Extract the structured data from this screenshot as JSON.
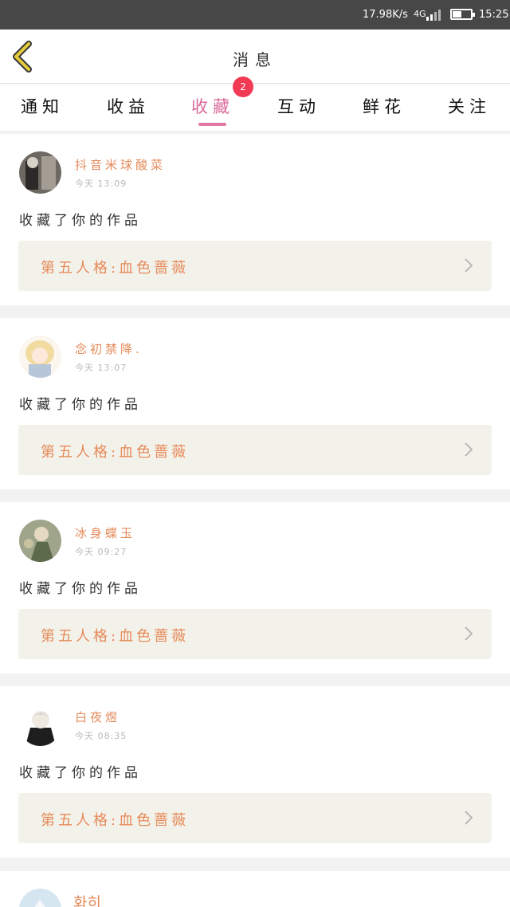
{
  "status_bar": {
    "speed": "17.98K/s",
    "network": "4G",
    "battery_level": 0.5,
    "time": "15:25"
  },
  "header": {
    "title": "消息",
    "accent_color": "#e4cc3a"
  },
  "tabs": [
    {
      "label": "通知"
    },
    {
      "label": "收益"
    },
    {
      "label": "收藏",
      "badge": "2",
      "active": true
    },
    {
      "label": "互动"
    },
    {
      "label": "鲜花"
    },
    {
      "label": "关注"
    }
  ],
  "messages": [
    {
      "username": "抖音米球酸菜",
      "time": "今天 13:09",
      "text": "收藏了你的作品",
      "work_title": "第五人格:血色蔷薇"
    },
    {
      "username": "念初禁降.",
      "time": "今天 13:07",
      "text": "收藏了你的作品",
      "work_title": "第五人格:血色蔷薇"
    },
    {
      "username": "冰身蝶玉",
      "time": "今天 09:27",
      "text": "收藏了你的作品",
      "work_title": "第五人格:血色蔷薇"
    },
    {
      "username": "白夜煜",
      "time": "今天 08:35",
      "text": "收藏了你的作品",
      "work_title": "第五人格:血色蔷薇"
    }
  ],
  "partial_message": {
    "username": "화히"
  },
  "colors": {
    "active_tab": "#d96a9a",
    "badge": "#f23a55",
    "username": "#e58a5a",
    "work_card_bg": "#f3f2ea"
  }
}
